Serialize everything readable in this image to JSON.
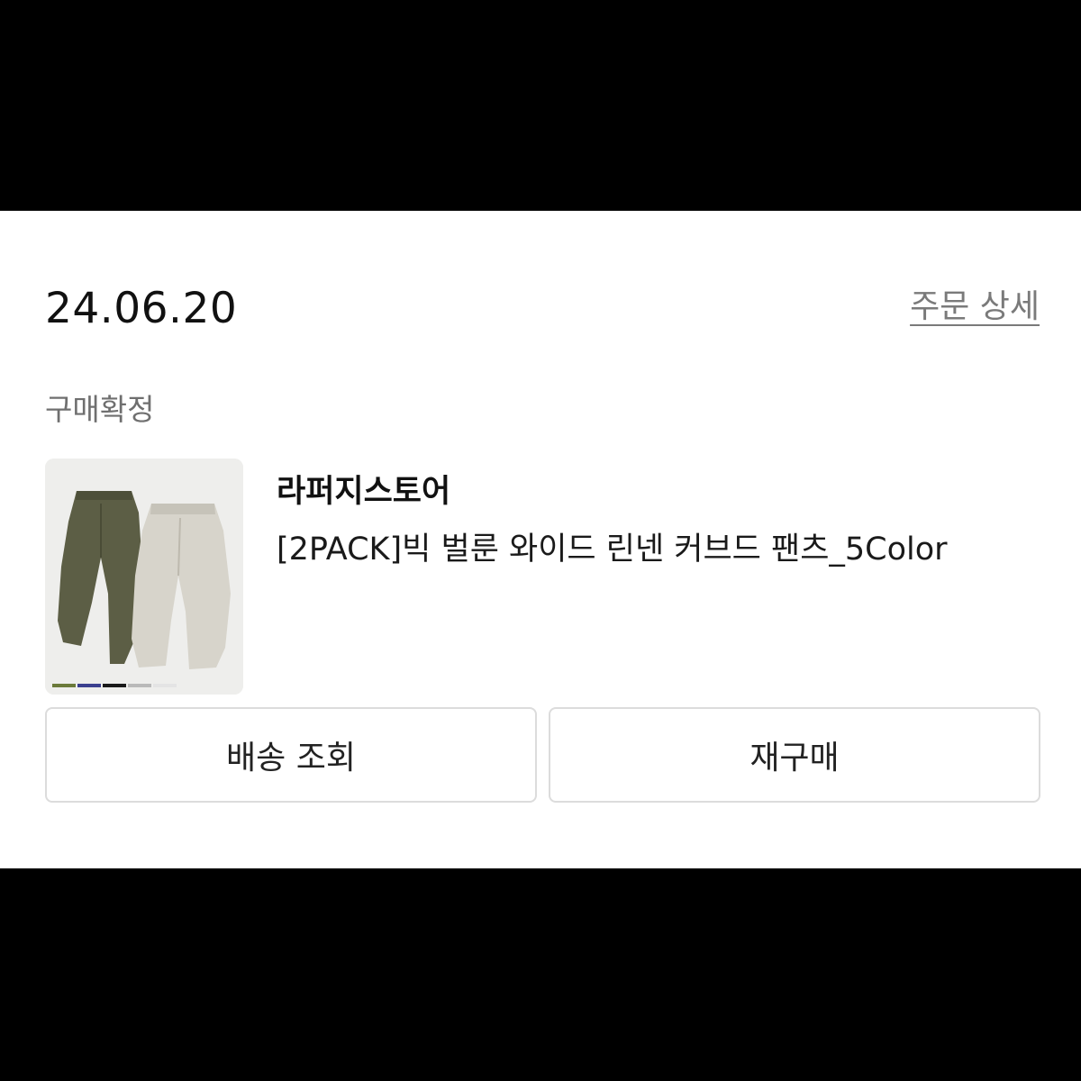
{
  "order": {
    "date": "24.06.20",
    "detail_link": "주문 상세",
    "status": "구매확정"
  },
  "product": {
    "store": "라퍼지스토어",
    "name": "[2PACK]빅 벌룬 와이드 린넨 커브드 팬츠_5Color",
    "image_icon": "pants-product-photo",
    "swatch_colors": [
      "#6b7a3a",
      "#3b3f8f",
      "#1a1a1a",
      "#b9b9b9",
      "#e4e4e4"
    ],
    "pants_colors": [
      "#5c5e45",
      "#d7d4cb"
    ]
  },
  "actions": {
    "shipping_label": "배송 조회",
    "rebuy_label": "재구매"
  }
}
